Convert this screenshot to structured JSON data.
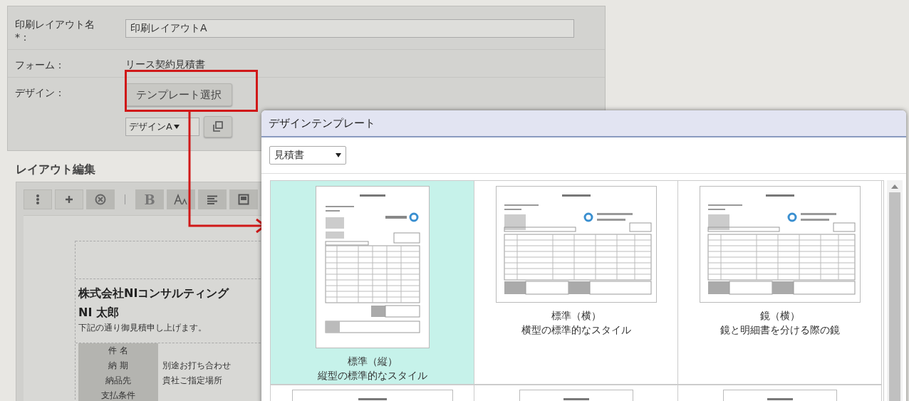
{
  "form": {
    "fields": [
      {
        "kind": "input",
        "label": "印刷レイアウト名 *：",
        "value": "印刷レイアウトA"
      },
      {
        "kind": "text",
        "label": "フォーム：",
        "value": "リース契約見積書"
      },
      {
        "kind": "design",
        "label": "デザイン：",
        "button": "テンプレート選択",
        "select": "デザインA"
      }
    ]
  },
  "editor": {
    "title": "レイアウト編集",
    "bold_label": "B",
    "company": "株式会社NIコンサルティング",
    "person": "NI 太郎",
    "greeting": "下記の通り御見積申し上げます。",
    "rows": [
      {
        "label": "件 名"
      },
      {
        "label": "納 期",
        "value": "別途お打ち合わせ"
      },
      {
        "label": "納品先",
        "value": "貴社ご指定場所"
      },
      {
        "label": "支払条件"
      }
    ]
  },
  "dialog": {
    "title": "デザインテンプレート",
    "category": "見積書",
    "templates": [
      {
        "kind": "portrait",
        "name": "標準（縦）",
        "description": "縦型の標準的なスタイル",
        "selected": true
      },
      {
        "kind": "landscape",
        "name": "標準（横）",
        "description": "横型の標準的なスタイル",
        "selected": false
      },
      {
        "kind": "landscape",
        "name": "鏡（横）",
        "description": "鏡と明細書を分ける際の鏡",
        "selected": false
      },
      {
        "kind": "landscape",
        "selected": false
      },
      {
        "kind": "portrait",
        "selected": false
      },
      {
        "kind": "portrait",
        "selected": false
      }
    ]
  }
}
